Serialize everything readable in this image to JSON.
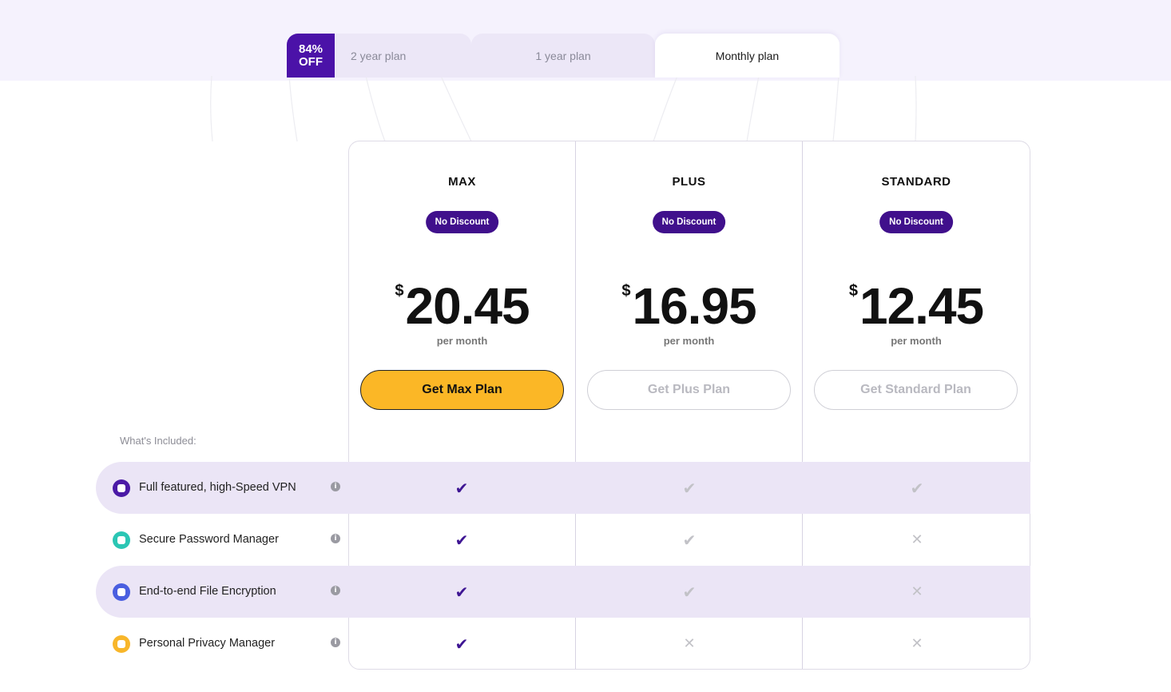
{
  "tabs": {
    "discount_line1": "84%",
    "discount_line2": "OFF",
    "two_year": "2 year plan",
    "one_year": "1 year plan",
    "monthly": "Monthly plan"
  },
  "plans": [
    {
      "name": "MAX",
      "badge": "No Discount",
      "currency": "$",
      "price": "20.45",
      "period": "per month",
      "button": "Get Max Plan"
    },
    {
      "name": "PLUS",
      "badge": "No Discount",
      "currency": "$",
      "price": "16.95",
      "period": "per month",
      "button": "Get Plus Plan"
    },
    {
      "name": "STANDARD",
      "badge": "No Discount",
      "currency": "$",
      "price": "12.45",
      "period": "per month",
      "button": "Get Standard Plan"
    }
  ],
  "whats_included": "What's Included:",
  "features": [
    {
      "label": "Full featured, high-Speed VPN",
      "icon": "vpn-shield-icon",
      "icon_color": "#4b1aa6",
      "availability": [
        "included",
        "included",
        "included"
      ]
    },
    {
      "label": "Secure Password Manager",
      "icon": "password-manager-icon",
      "icon_color": "#2bc6b4",
      "availability": [
        "included",
        "included",
        "not-included"
      ]
    },
    {
      "label": "End-to-end File Encryption",
      "icon": "file-encryption-icon",
      "icon_color": "#4a5fe0",
      "availability": [
        "included",
        "included",
        "not-included"
      ]
    },
    {
      "label": "Personal Privacy Manager",
      "icon": "privacy-manager-icon",
      "icon_color": "#f8b62a",
      "availability": [
        "included",
        "not-included",
        "not-included"
      ]
    }
  ],
  "info_glyph": "i",
  "check_glyph": "✔",
  "cross_glyph": "✕",
  "colors": {
    "accent": "#4b12a8",
    "badge": "#40108c",
    "primary_button": "#fbb726",
    "shaded_row": "#ebe5f6"
  }
}
